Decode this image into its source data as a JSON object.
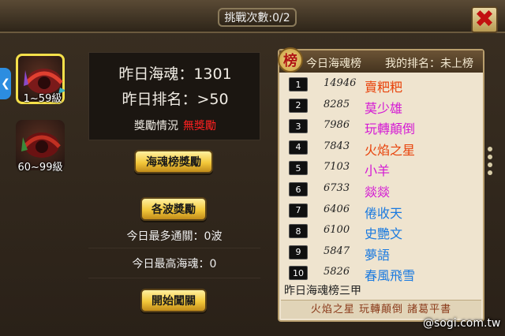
{
  "header": {
    "challenge_count": "挑戰次數:0/2"
  },
  "tabs": [
    {
      "label": "1~59級",
      "active": true
    },
    {
      "label": "60~99級",
      "active": false
    }
  ],
  "stats": {
    "yesterday_soul": "昨日海魂：1301",
    "yesterday_rank": "昨日排名：>50",
    "reward_label": "獎勵情況",
    "reward_value": "無獎勵"
  },
  "buttons": {
    "rank_reward": "海魂榜獎勵",
    "wave_reward": "各波獎勵",
    "start": "開始闖關"
  },
  "info": {
    "max_pass": "今日最多通關：0波",
    "max_soul": "今日最高海魂：0"
  },
  "ranking": {
    "badge": "榜",
    "title": "今日海魂榜",
    "my_rank": "我的排名：未上榜",
    "rows": [
      {
        "rank": "1",
        "score": "14946",
        "name": "賣粑粑",
        "color": "#e8420a"
      },
      {
        "rank": "2",
        "score": "8285",
        "name": "莫少雄",
        "color": "#d418d4"
      },
      {
        "rank": "3",
        "score": "7986",
        "name": "玩轉顛倒",
        "color": "#d418d4"
      },
      {
        "rank": "4",
        "score": "7843",
        "name": "火焰之星",
        "color": "#e8420a"
      },
      {
        "rank": "5",
        "score": "7103",
        "name": "小羊",
        "color": "#d418d4"
      },
      {
        "rank": "6",
        "score": "6733",
        "name": "燚燚",
        "color": "#d418d4"
      },
      {
        "rank": "7",
        "score": "6406",
        "name": "倦收天",
        "color": "#1a7ae0"
      },
      {
        "rank": "8",
        "score": "6100",
        "name": "史艷文",
        "color": "#1a7ae0"
      },
      {
        "rank": "9",
        "score": "5847",
        "name": "夢語",
        "color": "#1a7ae0"
      },
      {
        "rank": "10",
        "score": "5826",
        "name": "春風飛雪",
        "color": "#1a7ae0"
      }
    ],
    "yesterday_top3_title": "昨日海魂榜三甲",
    "yesterday_top3": "火焰之星  玩轉顛倒  諸葛平書"
  },
  "watermark": "@sogi.com.tw"
}
